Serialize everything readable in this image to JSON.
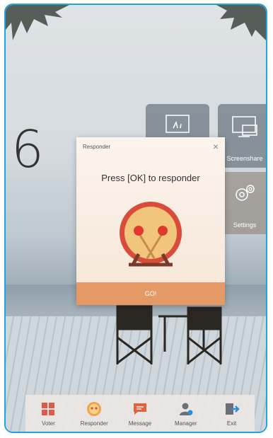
{
  "clock": {
    "digit": "6"
  },
  "tiles": [
    {
      "label": ""
    },
    {
      "label": "Screenshare"
    },
    {
      "label": "Settings"
    }
  ],
  "dialog": {
    "title": "Responder",
    "close": "×",
    "prompt": "Press [OK] to responder",
    "go_label": "GO!"
  },
  "taskbar": [
    {
      "label": "Voter",
      "icon": "voter-icon"
    },
    {
      "label": "Responder",
      "icon": "responder-icon"
    },
    {
      "label": "Message",
      "icon": "message-icon"
    },
    {
      "label": "Manager",
      "icon": "manager-icon"
    },
    {
      "label": "Exit",
      "icon": "exit-icon"
    }
  ],
  "colors": {
    "frame": "#1aa6de",
    "accent": "#e59a66",
    "drum_red": "#d94b3a"
  }
}
